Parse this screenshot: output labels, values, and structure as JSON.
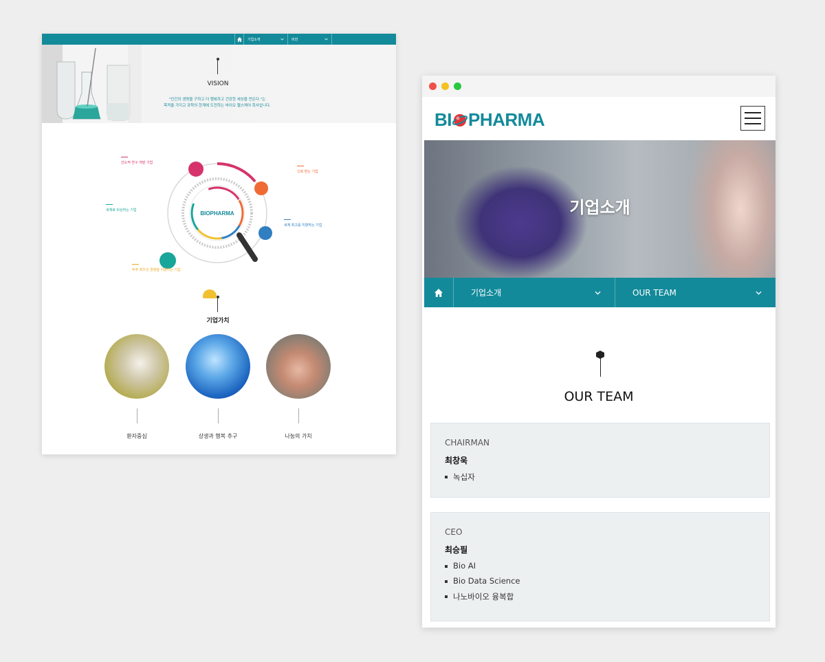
{
  "desktop": {
    "nav": {
      "select1": "기업소개",
      "select2": "비전"
    },
    "vision": {
      "title": "VISION",
      "text_line1": "\"인간의 생명을 구하고 더 행복하고 건강한 세상을 만든다.\"는",
      "text_line2": "목적을 가지고 과학의 한계에 도전하는 바이오 헬스케어 회사입니다."
    },
    "diagram": {
      "center_logo": "BIOPHARMA",
      "labels": [
        {
          "text": "선도적 연구 개발 기업",
          "color": "#d6336c"
        },
        {
          "text": "신뢰 받는 기업",
          "color": "#f06a35"
        },
        {
          "text": "세계로 비상하는 기업",
          "color": "#18a69a"
        },
        {
          "text": "세계 최고를 지향하는 기업",
          "color": "#2f7fc1"
        },
        {
          "text": "주주 최우선 경영을 지향하는 기업",
          "color": "#f0a623"
        }
      ]
    },
    "values": {
      "title": "기업가치",
      "items": [
        "환자중심",
        "상생과 행복 추구",
        "나눔의 가치"
      ]
    }
  },
  "mobile": {
    "logo": {
      "pre": "BI",
      "post": "PHARMA"
    },
    "banner_title": "기업소개",
    "nav": {
      "select1": "기업소개",
      "select2": "OUR TEAM"
    },
    "team_title": "OUR TEAM",
    "members": [
      {
        "role": "CHAIRMAN",
        "name": "최창욱",
        "items": [
          "녹십자"
        ]
      },
      {
        "role": "CEO",
        "name": "최승필",
        "items": [
          "Bio AI",
          "Bio Data Science",
          "나노바이오 융복합"
        ]
      }
    ]
  },
  "colors": {
    "brand": "#138a9a",
    "accent": "#d6336c"
  }
}
